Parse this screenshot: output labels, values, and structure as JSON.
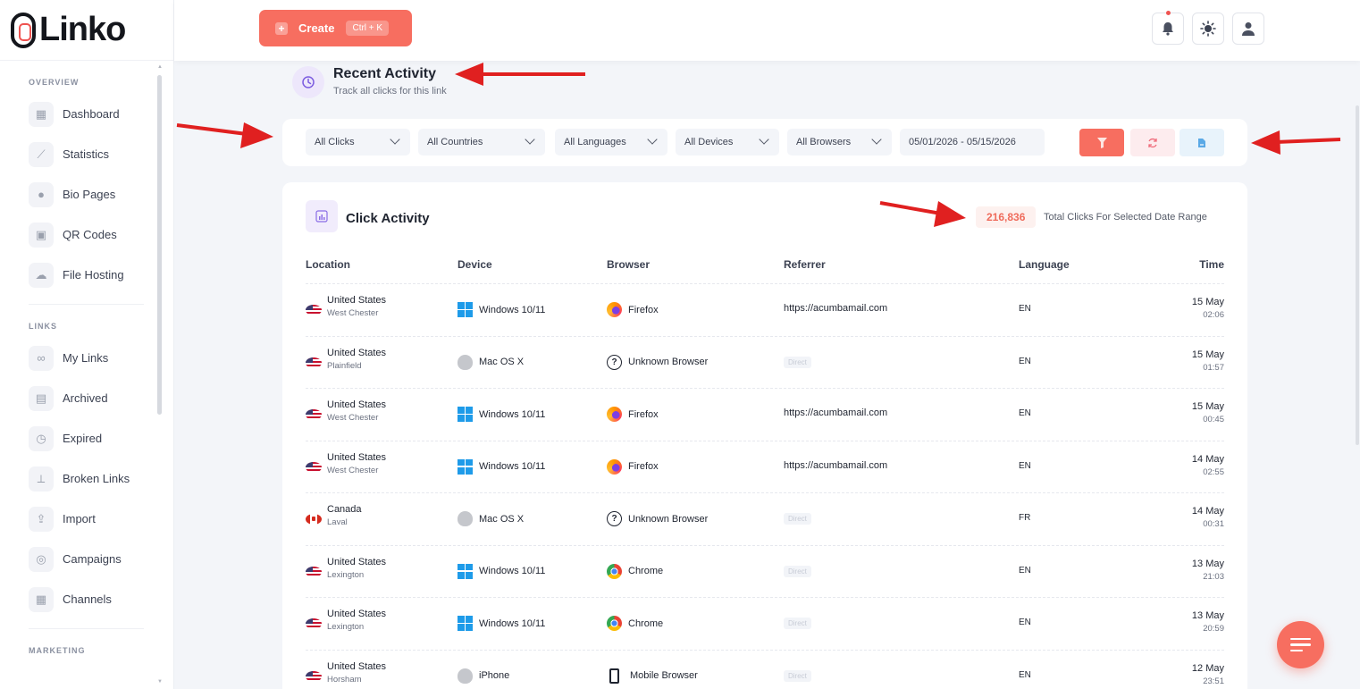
{
  "app": {
    "name": "Linko"
  },
  "sidebar": {
    "sections": [
      {
        "label": "OVERVIEW",
        "items": [
          {
            "label": "Dashboard",
            "icon": "dashboard-icon"
          },
          {
            "label": "Statistics",
            "icon": "chart-icon"
          },
          {
            "label": "Bio Pages",
            "icon": "users-icon"
          },
          {
            "label": "QR Codes",
            "icon": "qr-code-icon"
          },
          {
            "label": "File Hosting",
            "icon": "cloud-icon"
          }
        ]
      },
      {
        "label": "LINKS",
        "items": [
          {
            "label": "My Links",
            "icon": "link-icon"
          },
          {
            "label": "Archived",
            "icon": "archive-icon"
          },
          {
            "label": "Expired",
            "icon": "clock-icon"
          },
          {
            "label": "Broken Links",
            "icon": "broken-link-icon"
          },
          {
            "label": "Import",
            "icon": "import-icon"
          },
          {
            "label": "Campaigns",
            "icon": "target-icon"
          },
          {
            "label": "Channels",
            "icon": "grid-icon"
          }
        ]
      },
      {
        "label": "MARKETING",
        "items": []
      }
    ]
  },
  "header": {
    "create_label": "Create",
    "create_shortcut": "Ctrl + K",
    "icons": [
      "bell-icon",
      "sun-icon",
      "user-icon"
    ]
  },
  "activity": {
    "title": "Recent Activity",
    "subtitle": "Track all clicks for this link"
  },
  "filters": {
    "clicks": "All Clicks",
    "countries": "All Countries",
    "languages": "All Languages",
    "devices": "All Devices",
    "browsers": "All Browsers",
    "date_range": "05/01/2026 - 05/15/2026",
    "buttons": [
      "filter-icon",
      "refresh-icon",
      "export-icon"
    ]
  },
  "click_activity": {
    "title": "Click Activity",
    "total_clicks": "216,836",
    "total_label": "Total Clicks For Selected Date Range",
    "columns": [
      "Location",
      "Device",
      "Browser",
      "Referrer",
      "Language",
      "Time"
    ],
    "rows": [
      {
        "country": "United States",
        "city": "West Chester",
        "flag": "us",
        "device": "Windows 10/11",
        "device_icon": "windows",
        "browser": "Firefox",
        "browser_icon": "firefox",
        "referrer": "https://acumbamail.com",
        "language": "EN",
        "date": "15 May",
        "time": "02:06"
      },
      {
        "country": "United States",
        "city": "Plainfield",
        "flag": "us",
        "device": "Mac OS X",
        "device_icon": "apple",
        "browser": "Unknown Browser",
        "browser_icon": "unknown",
        "referrer": "Direct",
        "language": "EN",
        "date": "15 May",
        "time": "01:57"
      },
      {
        "country": "United States",
        "city": "West Chester",
        "flag": "us",
        "device": "Windows 10/11",
        "device_icon": "windows",
        "browser": "Firefox",
        "browser_icon": "firefox",
        "referrer": "https://acumbamail.com",
        "language": "EN",
        "date": "15 May",
        "time": "00:45"
      },
      {
        "country": "United States",
        "city": "West Chester",
        "flag": "us",
        "device": "Windows 10/11",
        "device_icon": "windows",
        "browser": "Firefox",
        "browser_icon": "firefox",
        "referrer": "https://acumbamail.com",
        "language": "EN",
        "date": "14 May",
        "time": "02:55"
      },
      {
        "country": "Canada",
        "city": "Laval",
        "flag": "ca",
        "device": "Mac OS X",
        "device_icon": "apple",
        "browser": "Unknown Browser",
        "browser_icon": "unknown",
        "referrer": "Direct",
        "language": "FR",
        "date": "14 May",
        "time": "00:31"
      },
      {
        "country": "United States",
        "city": "Lexington",
        "flag": "us",
        "device": "Windows 10/11",
        "device_icon": "windows",
        "browser": "Chrome",
        "browser_icon": "chrome",
        "referrer": "Direct",
        "language": "EN",
        "date": "13 May",
        "time": "21:03"
      },
      {
        "country": "United States",
        "city": "Lexington",
        "flag": "us",
        "device": "Windows 10/11",
        "device_icon": "windows",
        "browser": "Chrome",
        "browser_icon": "chrome",
        "referrer": "Direct",
        "language": "EN",
        "date": "13 May",
        "time": "20:59"
      },
      {
        "country": "United States",
        "city": "Horsham",
        "flag": "us",
        "device": "iPhone",
        "device_icon": "apple",
        "browser": "Mobile Browser",
        "browser_icon": "mobile",
        "referrer": "Direct",
        "language": "EN",
        "date": "12 May",
        "time": "23:51"
      }
    ]
  },
  "colors": {
    "accent": "#f76e60",
    "arrow": "#e02020",
    "sidebar_bg": "#ffffff",
    "page_bg": "#f3f5f9"
  }
}
